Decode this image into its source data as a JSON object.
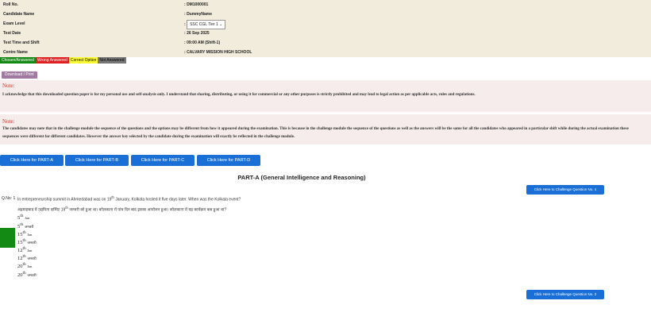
{
  "info": {
    "rows": [
      {
        "label": "Roll No.",
        "value": "DM1000001"
      },
      {
        "label": "Candidate Name",
        "value": "DummyName"
      },
      {
        "label": "Exam Level",
        "value": "SSC CGL Tier 1"
      },
      {
        "label": "Test Date",
        "value": "26 Sep 2025"
      },
      {
        "label": "Test Time and Shift",
        "value": "09:00 AM (Shift-1)"
      },
      {
        "label": "Centre Name",
        "value": "CALVARY MISSION HIGH SCHOOL"
      }
    ]
  },
  "legend": [
    {
      "label": "Chosen/Answered",
      "bg": "#138a13",
      "fg": "#ffffff"
    },
    {
      "label": "Wrong Answered",
      "bg": "#e02020",
      "fg": "#ffffff"
    },
    {
      "label": "Correct Option",
      "bg": "#ffff33",
      "fg": "#000000"
    },
    {
      "label": "Not Answered",
      "bg": "#777777",
      "fg": "#000000"
    }
  ],
  "download_label": "Download / Print",
  "notes": [
    {
      "title": "Note:",
      "text": "I acknowledge that this downloaded question paper is for my personal use and self-analysis only. I understand that sharing, distributing, or using it for commercial or any other purposes is strictly prohibited and may lead to legal action as per applicable acts, rules and regulations."
    },
    {
      "title": "Note:",
      "text": "The candidates may note that in the challenge module the sequence of the questions and the options may be different from how it appeared during the examination. This is because in the challenge module the sequence of the questions as well as the answers will be the same for all the candidates who appeared in a particular shift while during the actual examination these sequences were different for different candidates. However the answer key selected by the candidate during the examination will exactly be reflected in the challenge module."
    }
  ],
  "part_buttons": [
    "Click Here for PART-A",
    "Click Here for PART-B",
    "Click Here for PART-C",
    "Click Here for PART-D"
  ],
  "part_title": "PART-A (General Intelligence and Reasoning)",
  "challenge_buttons": [
    "Click Here to Challenge Question No. 1",
    "Click Here to Challenge Question No. 2"
  ],
  "question": {
    "number": "Q.No: 1",
    "english_pre": "In entrepreneurship summit in Ahmedabad was on 19",
    "english_sup": "th",
    "english_post": " January, Kolkata hosted it five days later. When was the Kolkata event?",
    "hindi_pre": "अहमदाबाद में उद्यमिता सम्मिट 19",
    "hindi_sup": "th",
    "hindi_post": " जनवरी को हुआ था। कोलकाता में पांच दिन बाद इसका आयोजन हुआ। कोलकाता में यह कार्यक्रम कब हुआ था?",
    "options": [
      {
        "num": "5",
        "sup": "th",
        "suffix": "Jan"
      },
      {
        "num": "5",
        "sup": "th",
        "suffix": "जनवरी"
      },
      {
        "num": "15",
        "sup": "th",
        "suffix": "Jan"
      },
      {
        "num": "15",
        "sup": "th",
        "suffix": "जनवरी"
      },
      {
        "num": "12",
        "sup": "th",
        "suffix": "Jan"
      },
      {
        "num": "12",
        "sup": "th",
        "suffix": "जनवरी"
      },
      {
        "num": "20",
        "sup": "th",
        "suffix": "Jan"
      },
      {
        "num": "20",
        "sup": "th",
        "suffix": "जनवरी"
      }
    ]
  },
  "colors": {
    "info_bg": "#f1ecdc",
    "note_bg": "#f6ecec",
    "note_title": "#c0392b",
    "button_blue": "#1a6fd6",
    "download_btn": "#a07aa0",
    "correct_green": "#138a13"
  }
}
